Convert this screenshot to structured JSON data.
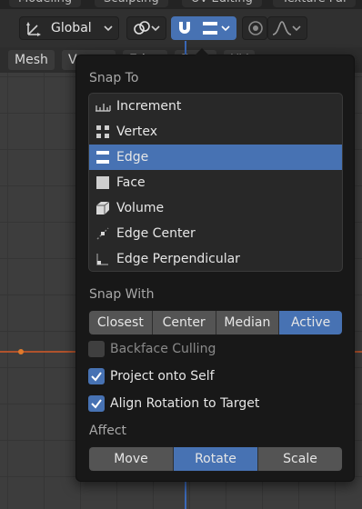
{
  "workspace_tabs": [
    "Modeling",
    "Sculpting",
    "UV Editing",
    "Texture Pai"
  ],
  "header": {
    "transform_orientation": "Global",
    "icons": {
      "orientation": "transform-orientation-icon",
      "pivot": "pivot-point-icon",
      "snap_toggle": "magnet-icon",
      "snap_element": "edge-snap-icon",
      "proportional": "proportional-edit-icon",
      "falloff": "falloff-curve-icon"
    }
  },
  "menubar": [
    "Mesh",
    "Vertex",
    "Edge",
    "Face",
    "UV"
  ],
  "popover": {
    "snap_to_label": "Snap To",
    "snap_to_items": [
      {
        "label": "Increment",
        "icon": "increment-icon",
        "active": false
      },
      {
        "label": "Vertex",
        "icon": "vertex-icon",
        "active": false
      },
      {
        "label": "Edge",
        "icon": "edge-icon",
        "active": true
      },
      {
        "label": "Face",
        "icon": "face-icon",
        "active": false
      },
      {
        "label": "Volume",
        "icon": "volume-icon",
        "active": false
      },
      {
        "label": "Edge Center",
        "icon": "edge-center-icon",
        "active": false
      },
      {
        "label": "Edge Perpendicular",
        "icon": "edge-perpendicular-icon",
        "active": false
      }
    ],
    "snap_with_label": "Snap With",
    "snap_with_options": [
      "Closest",
      "Center",
      "Median",
      "Active"
    ],
    "snap_with_selected": "Active",
    "checkboxes": [
      {
        "label": "Backface Culling",
        "checked": false,
        "enabled": false
      },
      {
        "label": "Project onto Self",
        "checked": true,
        "enabled": true
      },
      {
        "label": "Align Rotation to Target",
        "checked": true,
        "enabled": true
      }
    ],
    "affect_label": "Affect",
    "affect_options": [
      "Move",
      "Rotate",
      "Scale"
    ],
    "affect_selected": "Rotate"
  },
  "colors": {
    "accent": "#4772b3",
    "panel": "#181818",
    "x_axis": "#b0522c",
    "y_axis": "#3a68b8"
  }
}
